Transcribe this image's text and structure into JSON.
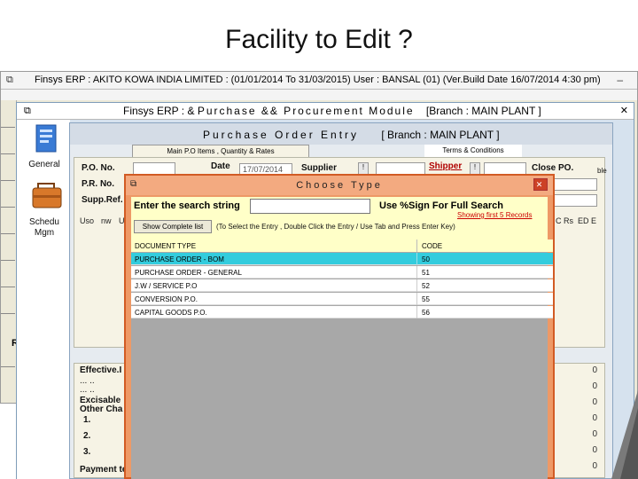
{
  "slide": {
    "title": "Facility to Edit ?"
  },
  "erp": {
    "title": "Finsys ERP : AKITO KOWA INDIA LIMITED : (01/01/2014 To 31/03/2015) User : BANSAL (01) (Ver.Build Date 16/07/2014 4:30 pm)",
    "min_glyph": "–",
    "side_letter": "R"
  },
  "module": {
    "title_prefix": "Finsys ERP : &",
    "title_spaced": "Purchase && Procurement Module",
    "branch": "[Branch : MAIN PLANT ]",
    "close_glyph": "✕",
    "side_items": [
      {
        "label": "General"
      },
      {
        "label": "Schedu Mgm"
      }
    ]
  },
  "po_form": {
    "title": "Purchase Order Entry",
    "branch": "[ Branch : MAIN PLANT ]",
    "tabs": [
      {
        "label": "Main P.O Items , Quantity & Rates"
      },
      {
        "label": "Terms & Conditions"
      }
    ],
    "fields": {
      "po_no": "P.O. No.",
      "date": "Date",
      "date_value": "17/07/2014",
      "supplier": "Supplier",
      "shipper": "Shipper",
      "close_po": "Close PO.",
      "pr_no": "P.R. No.",
      "supp_ref": "Supp.Ref.",
      "side_word": "ble",
      "btn_glyph": "!"
    },
    "grid_headers": [
      "Uso",
      "nw",
      "U",
      "C Rs",
      "ED E"
    ],
    "lower": {
      "effective": "Effective.I",
      "dots1": "... ..",
      "dots2": "... ..",
      "excisable": "Excisable",
      "other_charges": "Other Cha",
      "rows": [
        "1.",
        "2.",
        "3."
      ],
      "payment": "Payment te",
      "zeros": [
        "0",
        "0",
        "0",
        "0",
        "0",
        "0",
        "0"
      ]
    }
  },
  "dialog": {
    "title": "Choose Type",
    "close_glyph": "✕",
    "search_label": "Enter the search string",
    "search_value": "",
    "pct_label": "Use %Sign For Full Search",
    "showing_first": "Showing first 5 Records",
    "show_complete_btn": "Show Complete list",
    "hint": "(To Select the Entry , Double Click the Entry / Use Tab and Press Enter Key)",
    "columns": [
      "DOCUMENT TYPE",
      "CODE"
    ],
    "rows": [
      {
        "type": "PURCHASE ORDER - BOM",
        "code": "50",
        "selected": true
      },
      {
        "type": "PURCHASE ORDER - GENERAL",
        "code": "51",
        "selected": false
      },
      {
        "type": "J.W / SERVICE P.O",
        "code": "52",
        "selected": false
      },
      {
        "type": "CONVERSION P.O.",
        "code": "55",
        "selected": false
      },
      {
        "type": "CAPITAL GOODS P.O.",
        "code": "56",
        "selected": false
      }
    ]
  }
}
